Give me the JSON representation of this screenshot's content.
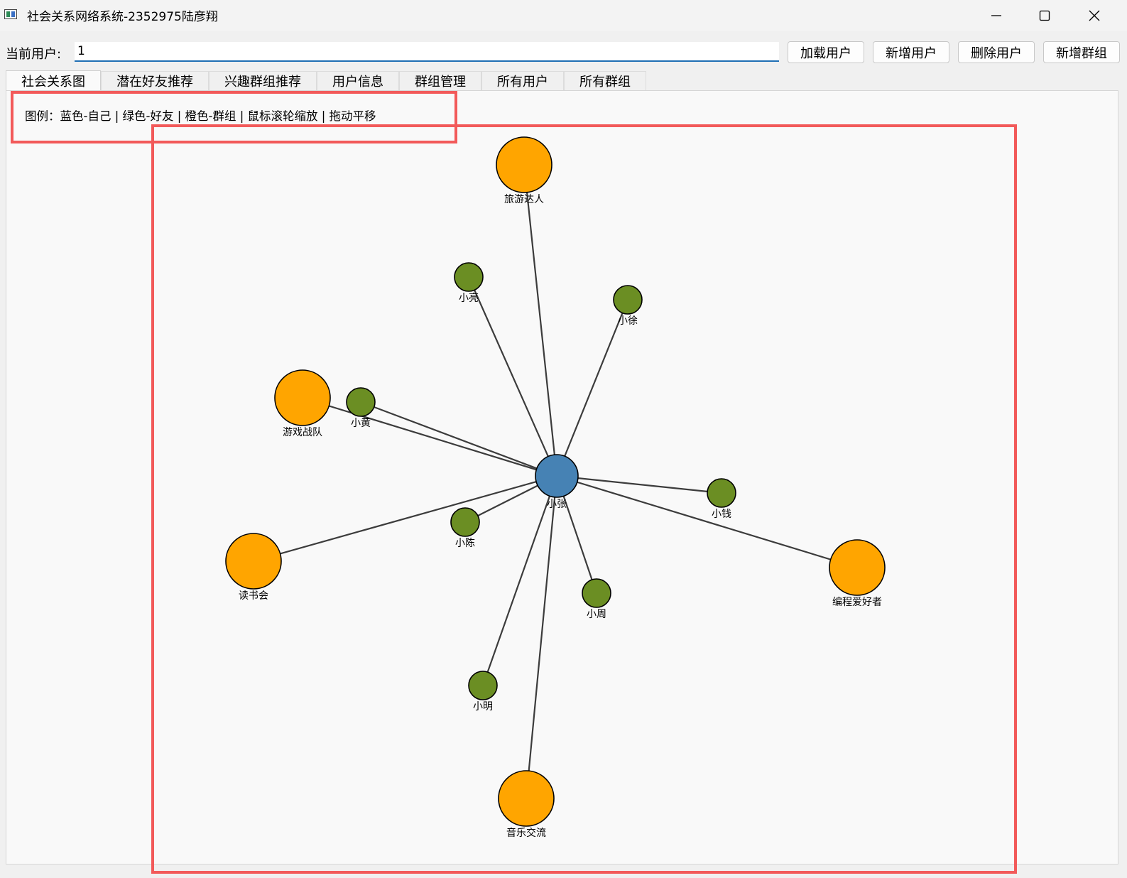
{
  "window": {
    "title": "社会关系网络系统-2352975陆彦翔",
    "controls": [
      "minimize",
      "maximize",
      "close"
    ]
  },
  "toolbar": {
    "user_label": "当前用户:",
    "user_value": "1",
    "buttons": [
      "加载用户",
      "新增用户",
      "删除用户",
      "新增群组"
    ]
  },
  "tabs": {
    "active": 0,
    "items": [
      "社会关系图",
      "潜在好友推荐",
      "兴趣群组推荐",
      "用户信息",
      "群组管理",
      "所有用户",
      "所有群组"
    ]
  },
  "legend": "图例：蓝色-自己 | 绿色-好友 | 橙色-群组 | 鼠标滚轮缩放 | 拖动平移",
  "colors": {
    "self": "#4682b4",
    "friend": "#6b8e23",
    "group": "#ffa500",
    "edge": "#3c3c3c",
    "highlight": "#f25a5a"
  },
  "graph": {
    "center": {
      "name": "小张",
      "type": "self"
    },
    "nodes": [
      {
        "name": "旅游达人",
        "type": "group"
      },
      {
        "name": "小亮",
        "type": "friend"
      },
      {
        "name": "小徐",
        "type": "friend"
      },
      {
        "name": "游戏战队",
        "type": "group"
      },
      {
        "name": "小黄",
        "type": "friend"
      },
      {
        "name": "小钱",
        "type": "friend"
      },
      {
        "name": "小陈",
        "type": "friend"
      },
      {
        "name": "读书会",
        "type": "group"
      },
      {
        "name": "编程爱好者",
        "type": "group"
      },
      {
        "name": "小周",
        "type": "friend"
      },
      {
        "name": "小明",
        "type": "friend"
      },
      {
        "name": "音乐交流",
        "type": "group"
      }
    ]
  }
}
